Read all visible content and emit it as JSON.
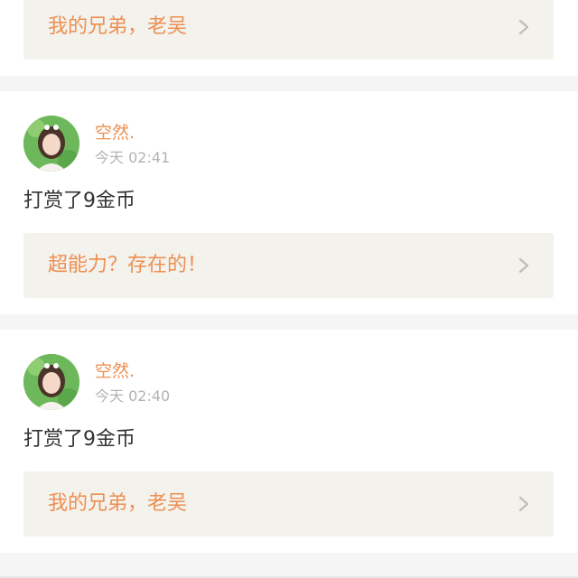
{
  "feed": {
    "top_item": {
      "link_title": "我的兄弟，老吴",
      "link_icon": "chevron-right-icon"
    },
    "items": [
      {
        "avatar_icon": "user-avatar",
        "username": "空然.",
        "time": "今天 02:41",
        "message": "打赏了9金币",
        "link_title": "超能力？存在的！",
        "link_icon": "chevron-right-icon"
      },
      {
        "avatar_icon": "user-avatar",
        "username": "空然.",
        "time": "今天 02:40",
        "message": "打赏了9金币",
        "link_title": "我的兄弟，老吴",
        "link_icon": "chevron-right-icon"
      }
    ]
  },
  "colors": {
    "accent": "#ee8f52",
    "meta": "#b3b3b3",
    "text": "#333333",
    "link_bg": "#f3f2ec",
    "page_bg": "#f5f5f5"
  }
}
